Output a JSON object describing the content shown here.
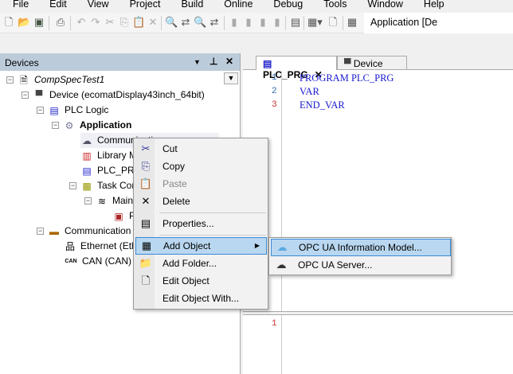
{
  "menu": [
    "File",
    "Edit",
    "View",
    "Project",
    "Build",
    "Online",
    "Debug",
    "Tools",
    "Window",
    "Help"
  ],
  "toolbar": {
    "active_app": "Application [De"
  },
  "devices": {
    "title": "Devices",
    "tree": [
      {
        "label": "CompSpecTest1",
        "icon": "project-icon"
      },
      {
        "label": "Device (ecomatDisplay43inch_64bit)",
        "icon": "device-icon"
      },
      {
        "label": "PLC Logic",
        "icon": "plc-logic-icon"
      },
      {
        "label": "Application",
        "icon": "gear-icon"
      },
      {
        "label": "Communicati",
        "icon": "cloud-icon"
      },
      {
        "label": "Library M",
        "icon": "library-icon"
      },
      {
        "label": "PLC_PRG",
        "icon": "pou-icon"
      },
      {
        "label": "Task Con",
        "icon": "task-config-icon"
      },
      {
        "label": "MainT",
        "icon": "task-icon"
      },
      {
        "label": "P",
        "icon": "call-icon"
      },
      {
        "label": "Communication (C",
        "icon": "communication-icon"
      },
      {
        "label": "Ethernet (Eth",
        "icon": "ethernet-icon"
      },
      {
        "label": "CAN (CAN)",
        "icon": "can-icon"
      }
    ]
  },
  "editor": {
    "tabs": [
      "PLC_PRG",
      "Device"
    ],
    "decl_lines": [
      {
        "n": "1",
        "text": "PROGRAM PLC_PRG"
      },
      {
        "n": "2",
        "text": "VAR"
      },
      {
        "n": "3",
        "text": "END_VAR"
      }
    ],
    "impl_lines": [
      {
        "n": "1",
        "text": ""
      }
    ]
  },
  "context_menu": [
    "Cut",
    "Copy",
    "Paste",
    "Delete",
    "Properties...",
    "Add Object",
    "Add Folder...",
    "Edit Object",
    "Edit Object With..."
  ],
  "submenu": [
    "OPC UA Information Model...",
    "OPC UA Server..."
  ]
}
